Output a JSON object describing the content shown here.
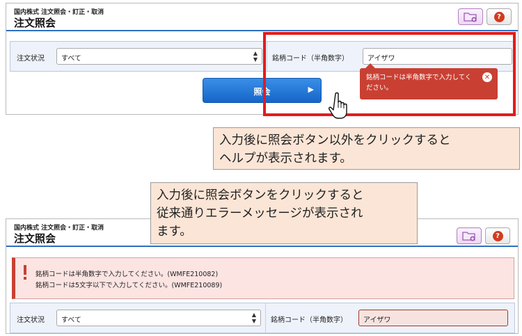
{
  "top_screen": {
    "breadcrumb": "国内株式 注文照会・訂正・取消",
    "title": "注文照会",
    "filter": {
      "status_label": "注文状況",
      "status_value": "すべて",
      "code_label": "銘柄コード（半角数字）",
      "code_value": "アイザワ"
    },
    "submit_label": "照会",
    "tooltip_text": "銘柄コードは半角数字で入力してください。"
  },
  "callout_1": "入力後に照会ボタン以外をクリックすると\nヘルプが表示されます。",
  "callout_2": "入力後に照会ボタンをクリックすると\n従来通りエラーメッセージが表示され\nます。",
  "bottom_screen": {
    "breadcrumb": "国内株式 注文照会・訂正・取消",
    "title": "注文照会",
    "errors": [
      "銘柄コードは半角数字で入力してください。(WMFE210082)",
      "銘柄コードは5文字以下で入力してください。(WMFE210089)"
    ],
    "filter": {
      "status_label": "注文状況",
      "status_value": "すべて",
      "code_label": "銘柄コード（半角数字）",
      "code_value": "アイザワ"
    }
  },
  "icons": {
    "folder_add": "folder-add-icon",
    "help": "help-icon",
    "tooltip_close": "close-icon",
    "error": "exclamation-icon",
    "cursor": "hand-pointer-icon",
    "select_arrow": "up-down-arrow-icon",
    "button_arrow": "chevron-right-icon"
  },
  "colors": {
    "primary_button": "#1f74d6",
    "header_rule": "#2d6fc0",
    "highlight_frame": "#e21c1c",
    "tooltip_bg": "#c94033",
    "callout_bg": "#fbe5d6",
    "error_banner_bg": "#fbe4e2"
  }
}
